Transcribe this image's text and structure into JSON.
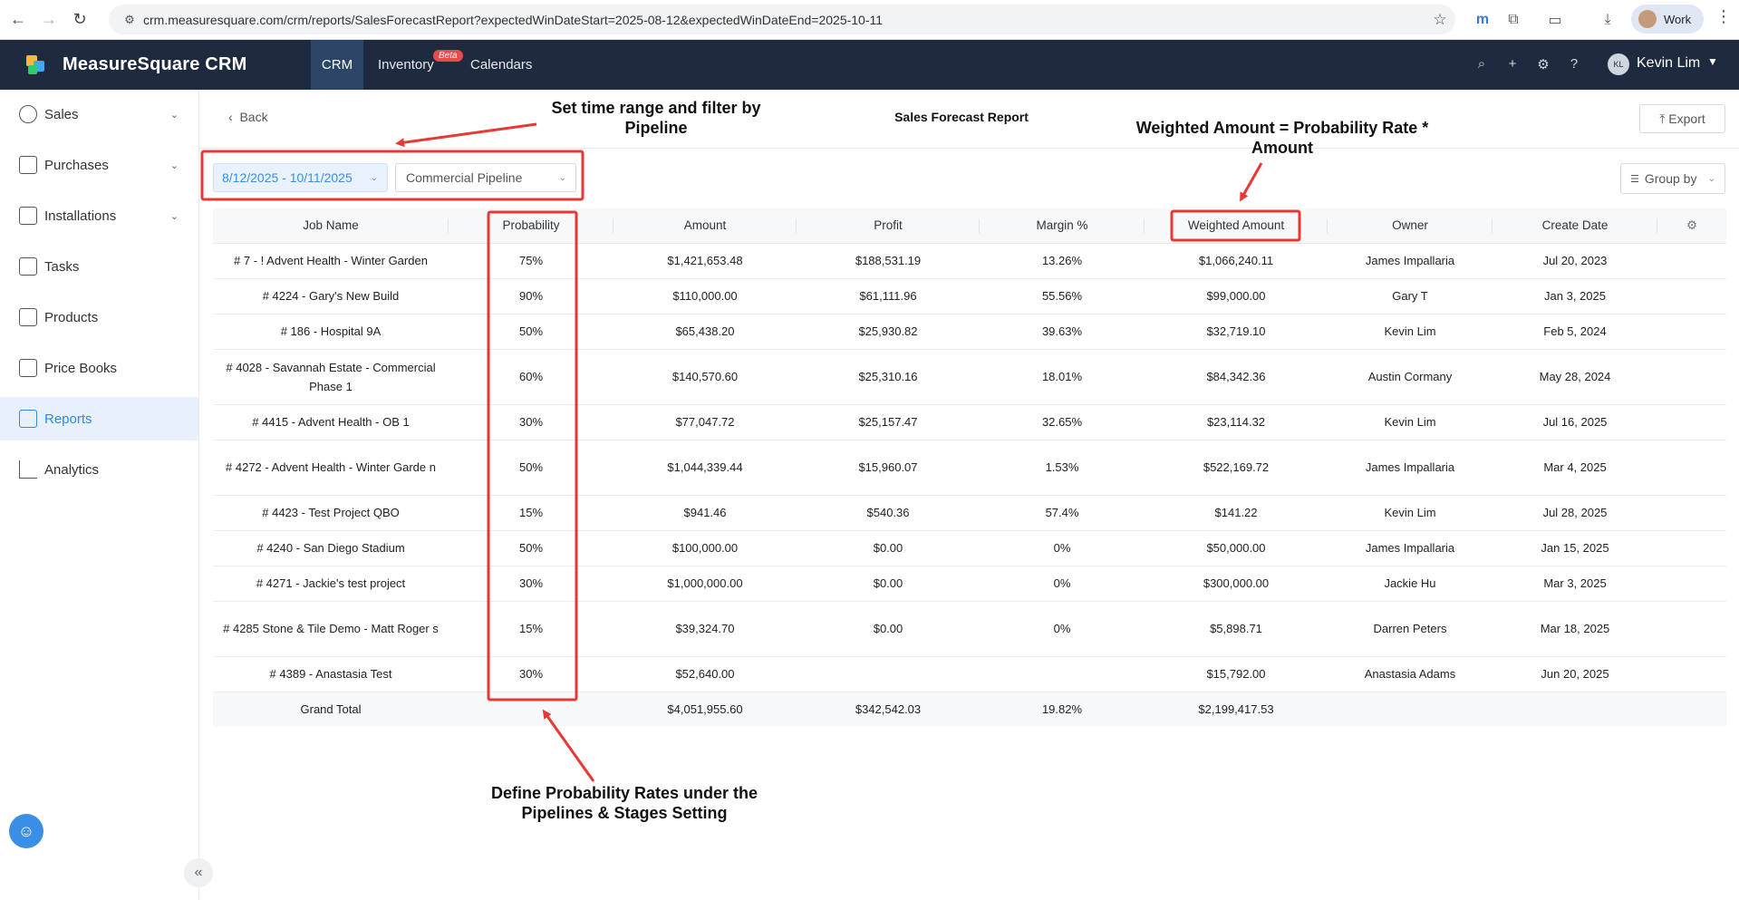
{
  "browser": {
    "url": "crm.measuresquare.com/crm/reports/SalesForecastReport?expectedWinDateStart=2025-08-12&expectedWinDateEnd=2025-10-11",
    "profile_label": "Work"
  },
  "app": {
    "brand": "MeasureSquare CRM",
    "tabs": [
      "CRM",
      "Inventory",
      "Calendars"
    ],
    "beta_badge": "Beta",
    "user_initials": "KL",
    "user_name": "Kevin Lim"
  },
  "sidebar": {
    "items": [
      {
        "label": "Sales",
        "icon": "dollar-icon",
        "expandable": true
      },
      {
        "label": "Purchases",
        "icon": "purchases-icon",
        "expandable": true
      },
      {
        "label": "Installations",
        "icon": "installations-icon",
        "expandable": true
      },
      {
        "label": "Tasks",
        "icon": "calendar-check-icon",
        "expandable": false
      },
      {
        "label": "Products",
        "icon": "box-icon",
        "expandable": false
      },
      {
        "label": "Price Books",
        "icon": "book-icon",
        "expandable": false
      },
      {
        "label": "Reports",
        "icon": "report-icon",
        "expandable": false,
        "active": true
      },
      {
        "label": "Analytics",
        "icon": "chart-line-icon",
        "expandable": false
      }
    ]
  },
  "header": {
    "back_label": "Back",
    "title": "Sales Forecast Report",
    "export_label": "Export"
  },
  "filters": {
    "date_range": "8/12/2025 - 10/11/2025",
    "pipeline": "Commercial Pipeline",
    "group_by_label": "Group by"
  },
  "table": {
    "columns": [
      "Job Name",
      "Probability",
      "Amount",
      "Profit",
      "Margin %",
      "Weighted Amount",
      "Owner",
      "Create Date"
    ],
    "rows": [
      [
        "# 7 - ! Advent Health - Winter Garden",
        "75%",
        "$1,421,653.48",
        "$188,531.19",
        "13.26%",
        "$1,066,240.11",
        "James Impallaria",
        "Jul 20, 2023"
      ],
      [
        "# 4224 - Gary's New Build",
        "90%",
        "$110,000.00",
        "$61,111.96",
        "55.56%",
        "$99,000.00",
        "Gary T",
        "Jan 3, 2025"
      ],
      [
        "# 186 - Hospital 9A",
        "50%",
        "$65,438.20",
        "$25,930.82",
        "39.63%",
        "$32,719.10",
        "Kevin Lim",
        "Feb 5, 2024"
      ],
      [
        "# 4028 - Savannah Estate - Commercial Phase 1",
        "60%",
        "$140,570.60",
        "$25,310.16",
        "18.01%",
        "$84,342.36",
        "Austin Cormany",
        "May 28, 2024"
      ],
      [
        "# 4415 - Advent Health - OB 1",
        "30%",
        "$77,047.72",
        "$25,157.47",
        "32.65%",
        "$23,114.32",
        "Kevin Lim",
        "Jul 16, 2025"
      ],
      [
        "# 4272 - Advent Health - Winter Garde n",
        "50%",
        "$1,044,339.44",
        "$15,960.07",
        "1.53%",
        "$522,169.72",
        "James Impallaria",
        "Mar 4, 2025"
      ],
      [
        "# 4423 - Test Project QBO",
        "15%",
        "$941.46",
        "$540.36",
        "57.4%",
        "$141.22",
        "Kevin Lim",
        "Jul 28, 2025"
      ],
      [
        "# 4240 - San Diego Stadium",
        "50%",
        "$100,000.00",
        "$0.00",
        "0%",
        "$50,000.00",
        "James Impallaria",
        "Jan 15, 2025"
      ],
      [
        "# 4271 - Jackie's test project",
        "30%",
        "$1,000,000.00",
        "$0.00",
        "0%",
        "$300,000.00",
        "Jackie Hu",
        "Mar 3, 2025"
      ],
      [
        "# 4285 Stone & Tile Demo - Matt Roger s",
        "15%",
        "$39,324.70",
        "$0.00",
        "0%",
        "$5,898.71",
        "Darren Peters",
        "Mar 18, 2025"
      ],
      [
        "# 4389 - Anastasia Test",
        "30%",
        "$52,640.00",
        "",
        "",
        "$15,792.00",
        "Anastasia Adams",
        "Jun 20, 2025"
      ]
    ],
    "total": [
      "Grand Total",
      "",
      "$4,051,955.60",
      "$342,542.03",
      "19.82%",
      "$2,199,417.53",
      "",
      ""
    ]
  },
  "annotations": {
    "filter_note": "Set time range and filter by Pipeline",
    "weighted_note": "Weighted Amount =  Probability Rate * Amount",
    "probability_note": "Define Probability Rates under the Pipelines & Stages Setting",
    "highlight_color": "#e53935"
  }
}
